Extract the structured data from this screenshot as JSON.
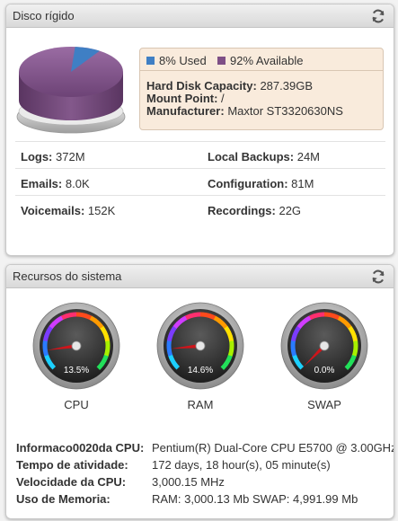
{
  "disk": {
    "title": "Disco rígido",
    "used_percent": 8,
    "available_percent": 92,
    "legend_used": "8% Used",
    "legend_available": "92% Available",
    "colors": {
      "used": "#3f7fc4",
      "available": "#7e4f86"
    },
    "capacity_label": "Hard Disk Capacity:",
    "capacity_value": "287.39GB",
    "mount_label": "Mount Point:",
    "mount_value": "/",
    "manufacturer_label": "Manufacturer:",
    "manufacturer_value": "Maxtor ST3320630NS",
    "stats": [
      {
        "left_label": "Logs:",
        "left_value": "372M",
        "right_label": "Local Backups:",
        "right_value": "24M"
      },
      {
        "left_label": "Emails:",
        "left_value": "8.0K",
        "right_label": "Configuration:",
        "right_value": "81M"
      },
      {
        "left_label": "Voicemails:",
        "left_value": "152K",
        "right_label": "Recordings:",
        "right_value": "22G"
      }
    ]
  },
  "system": {
    "title": "Recursos do sistema",
    "gauges": [
      {
        "name": "CPU",
        "value": 13.5,
        "value_text": "13.5%"
      },
      {
        "name": "RAM",
        "value": 14.6,
        "value_text": "14.6%"
      },
      {
        "name": "SWAP",
        "value": 0.0,
        "value_text": "0.0%"
      }
    ],
    "info": [
      {
        "label": "Informaco0020da CPU:",
        "value": "Pentium(R) Dual-Core CPU E5700 @ 3.00GHz"
      },
      {
        "label": "Tempo de atividade:",
        "value": "172 days, 18 hour(s), 05 minute(s)"
      },
      {
        "label": "Velocidade da CPU:",
        "value": "3,000.15 MHz"
      },
      {
        "label": "Uso de Memoria:",
        "value": "RAM: 3,000.13 Mb SWAP: 4,991.99 Mb"
      }
    ]
  }
}
